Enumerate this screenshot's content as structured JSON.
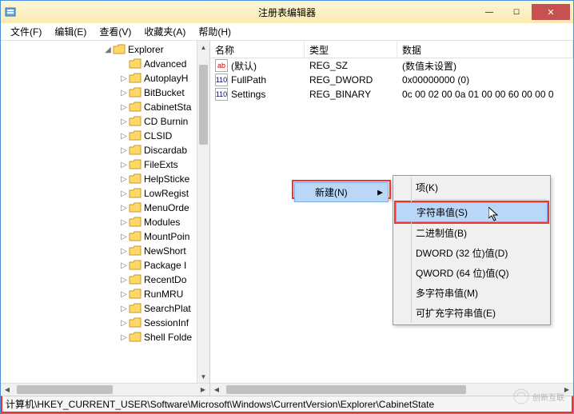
{
  "title": "注册表编辑器",
  "menubar": [
    "文件(F)",
    "编辑(E)",
    "查看(V)",
    "收藏夹(A)",
    "帮助(H)"
  ],
  "tree": {
    "root": "Explorer",
    "items": [
      "Advanced",
      "AutoplayH",
      "BitBucket",
      "CabinetSta",
      "CD Burnin",
      "CLSID",
      "Discardab",
      "FileExts",
      "HelpSticke",
      "LowRegist",
      "MenuOrde",
      "Modules",
      "MountPoin",
      "NewShort",
      "Package I",
      "RecentDo",
      "RunMRU",
      "SearchPlat",
      "SessionInf",
      "Shell Folde"
    ]
  },
  "columns": {
    "name": "名称",
    "type": "类型",
    "data": "数据"
  },
  "rows": [
    {
      "icon": "str",
      "name": "(默认)",
      "type": "REG_SZ",
      "data": "(数值未设置)"
    },
    {
      "icon": "bin",
      "name": "FullPath",
      "type": "REG_DWORD",
      "data": "0x00000000 (0)"
    },
    {
      "icon": "bin",
      "name": "Settings",
      "type": "REG_BINARY",
      "data": "0c 00 02 00 0a 01 00 00 60 00 00 0"
    }
  ],
  "ctx1": {
    "new": "新建(N)"
  },
  "ctx2": {
    "items": [
      "项(K)",
      "字符串值(S)",
      "二进制值(B)",
      "DWORD (32 位)值(D)",
      "QWORD (64 位)值(Q)",
      "多字符串值(M)",
      "可扩充字符串值(E)"
    ]
  },
  "statusbar": "计算机\\HKEY_CURRENT_USER\\Software\\Microsoft\\Windows\\CurrentVersion\\Explorer\\CabinetState",
  "watermark": "创新互联"
}
